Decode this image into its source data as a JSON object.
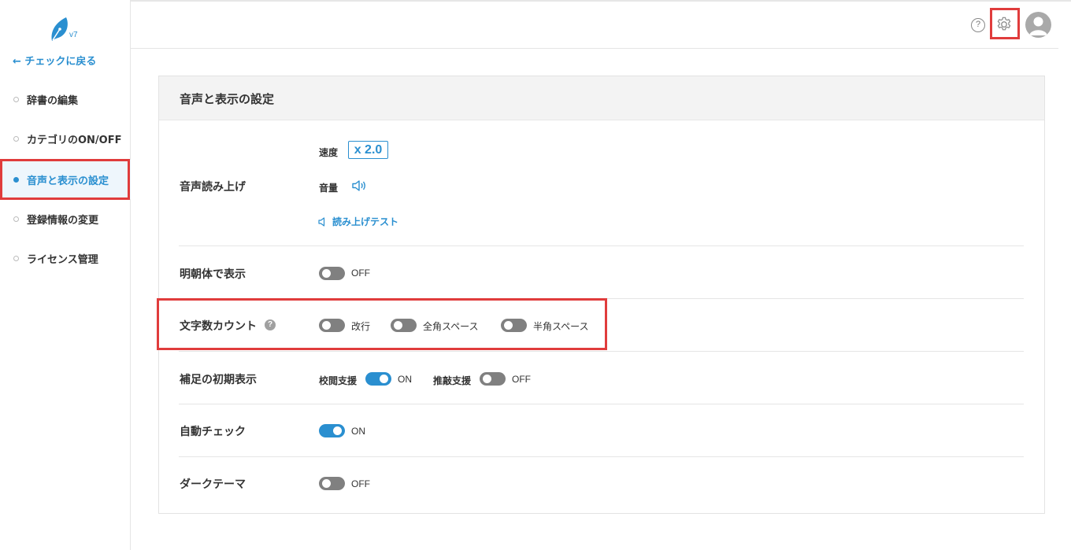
{
  "sidebar": {
    "logo_version": "v7",
    "back_label": "← チェックに戻る",
    "items": [
      {
        "label": "辞書の編集"
      },
      {
        "label": "カテゴリのON/OFF"
      },
      {
        "label": "音声と表示の設定"
      },
      {
        "label": "登録情報の変更"
      },
      {
        "label": "ライセンス管理"
      }
    ]
  },
  "header": {
    "help_symbol": "?",
    "icons": [
      "help-icon",
      "gear-icon",
      "avatar-icon"
    ]
  },
  "card": {
    "title": "音声と表示の設定",
    "speech": {
      "label": "音声読み上げ",
      "speed_label": "速度",
      "speed_value": "x 2.0",
      "volume_label": "音量",
      "test_label": "読み上げテスト"
    },
    "mincho": {
      "label": "明朝体で表示",
      "state": "OFF"
    },
    "char_count": {
      "label": "文字数カウント",
      "help_symbol": "?",
      "options": [
        {
          "label": "改行",
          "on": false
        },
        {
          "label": "全角スペース",
          "on": false
        },
        {
          "label": "半角スペース",
          "on": false
        }
      ]
    },
    "supplement": {
      "label": "補足の初期表示",
      "proofread_label": "校閲支援",
      "proofread_state": "ON",
      "polish_label": "推敲支援",
      "polish_state": "OFF"
    },
    "auto_check": {
      "label": "自動チェック",
      "state": "ON"
    },
    "dark_theme": {
      "label": "ダークテーマ",
      "state": "OFF"
    }
  },
  "colors": {
    "accent": "#2a8fd0",
    "highlight": "#e03c3c",
    "toggle_off": "#808080"
  }
}
